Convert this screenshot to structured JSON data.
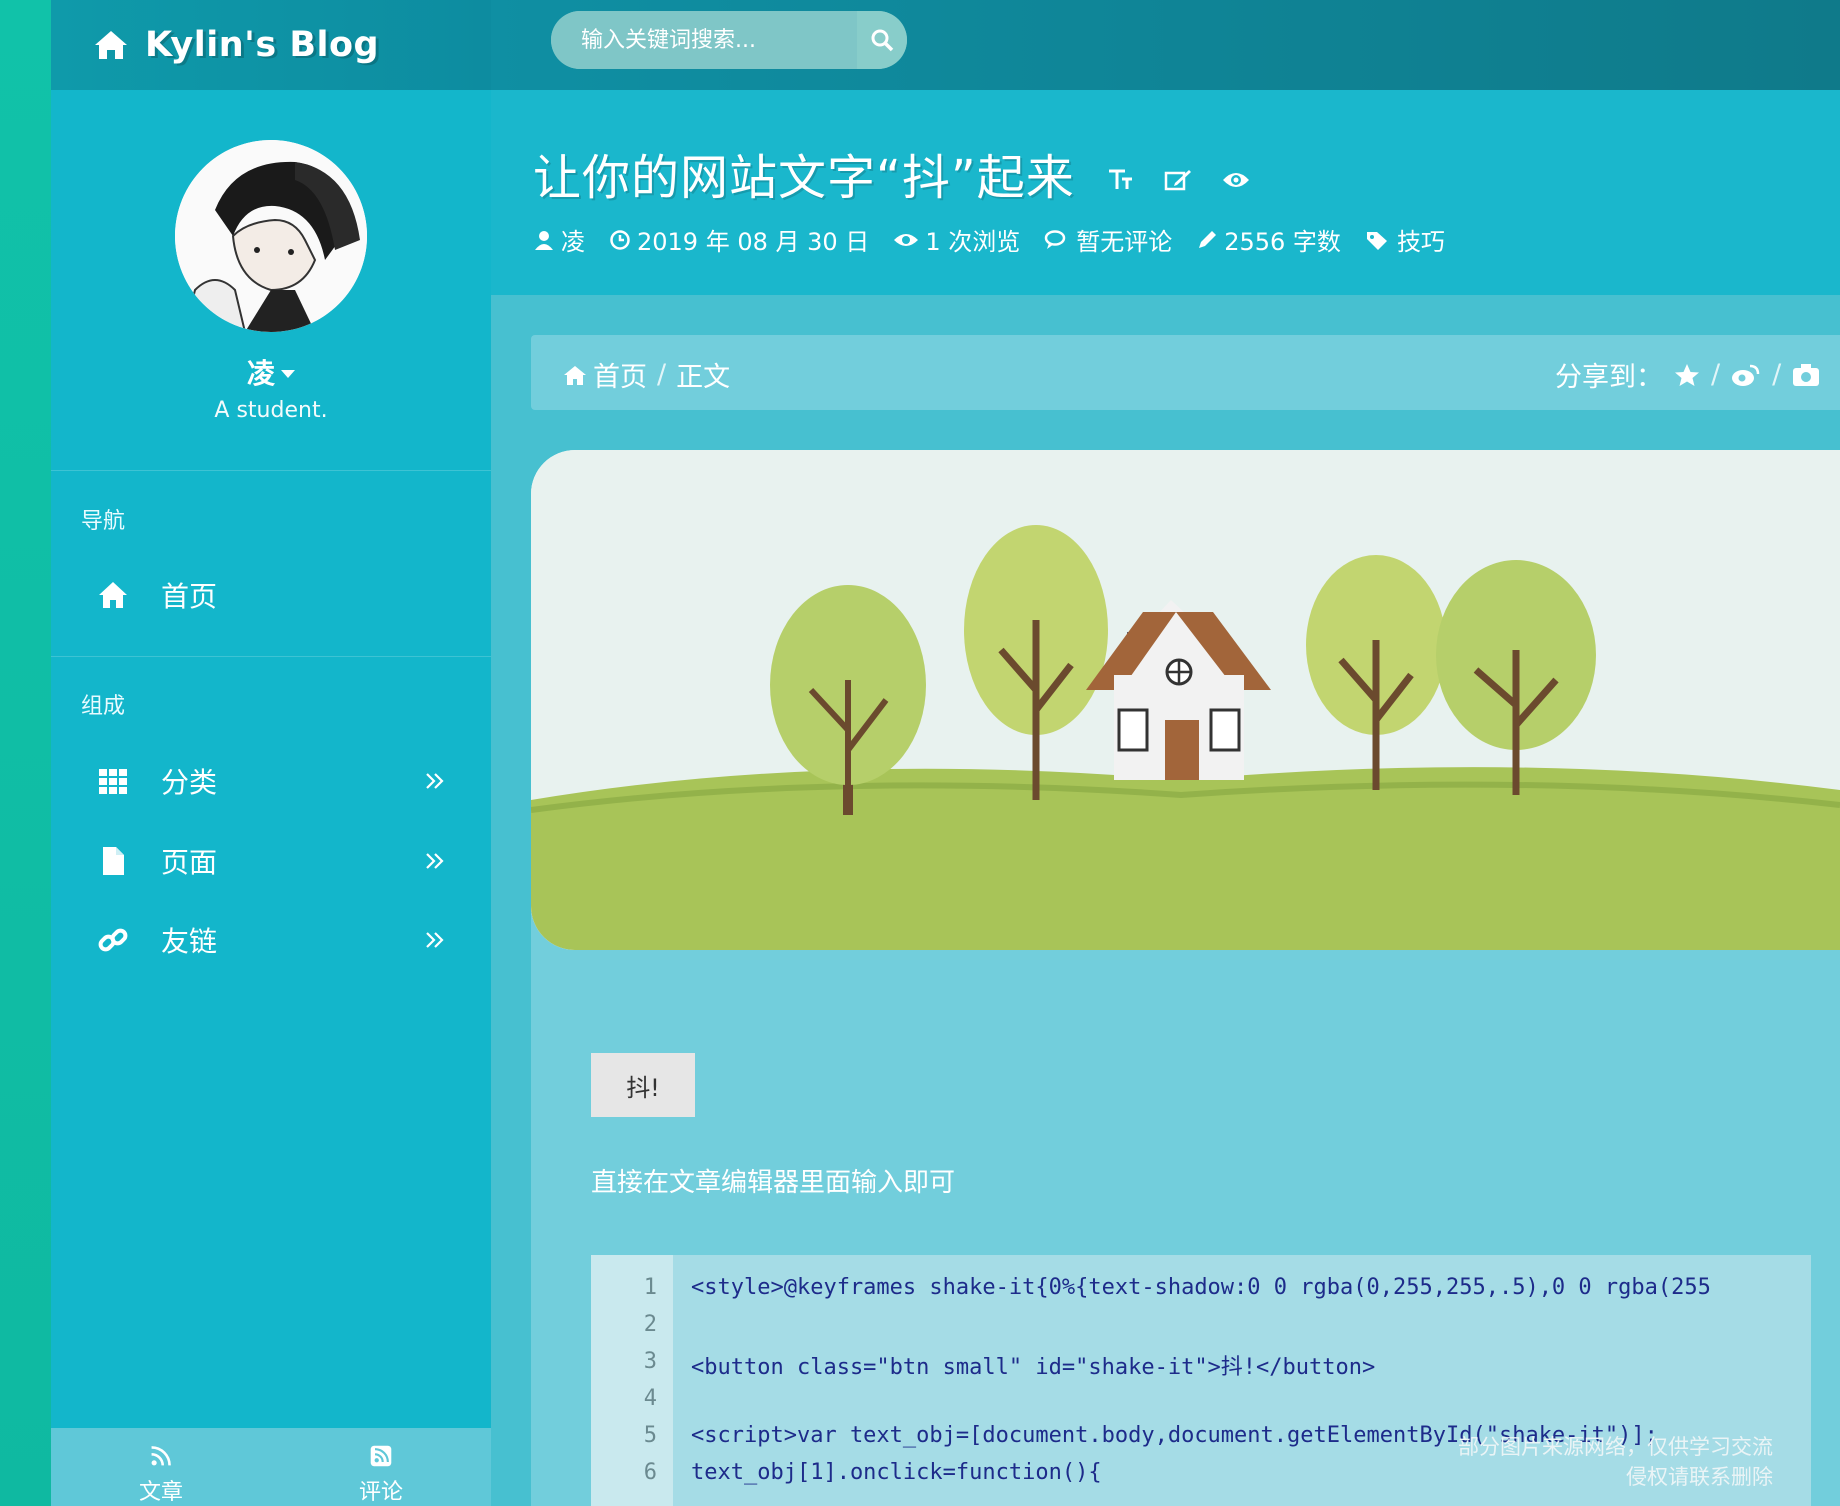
{
  "brand": {
    "title": "Kylin's Blog"
  },
  "search": {
    "placeholder": "输入关键词搜索..."
  },
  "profile": {
    "name": "凌",
    "role": "A student."
  },
  "nav": {
    "section1": "导航",
    "home": "首页",
    "section2": "组成",
    "items": [
      {
        "label": "分类",
        "icon": "grid-icon"
      },
      {
        "label": "页面",
        "icon": "file-icon"
      },
      {
        "label": "友链",
        "icon": "link-icon"
      }
    ]
  },
  "footer_tabs": [
    {
      "label": "文章",
      "icon": "rss-icon"
    },
    {
      "label": "评论",
      "icon": "rss-square-icon"
    }
  ],
  "post": {
    "title": "让你的网站文字“抖”起来",
    "meta": {
      "author": "凌",
      "date": "2019 年 08 月 30 日",
      "views": "1 次浏览",
      "comments": "暂无评论",
      "words": "2556 字数",
      "tag": "技巧"
    }
  },
  "breadcrumb": {
    "home": "首页",
    "sep": "/",
    "current": "正文"
  },
  "share": {
    "label": "分享到：",
    "sep": "/"
  },
  "article": {
    "button": "抖!",
    "desc": "直接在文章编辑器里面输入即可"
  },
  "code": {
    "lines": [
      {
        "n": "1",
        "text": "<style>@keyframes shake-it{0%{text-shadow:0 0 rgba(0,255,255,.5),0 0 rgba(255"
      },
      {
        "n": "2",
        "text": ""
      },
      {
        "n": "3",
        "text": "<button class=\"btn small\" id=\"shake-it\">抖!</button>"
      },
      {
        "n": "4",
        "text": ""
      },
      {
        "n": "5",
        "text": "<script>var text_obj=[document.body,document.getElementById(\"shake-it\")];"
      },
      {
        "n": "6",
        "text": "    text_obj[1].onclick=function(){"
      }
    ]
  },
  "notice": {
    "line1": "部分图片来源网络，仅供学习交流",
    "line2": "侵权请联系删除"
  },
  "colors": {
    "sidebar": "#13b6cb",
    "topbar": "#0f8fa3",
    "content": "#47c0d0",
    "card": "#72cedc"
  }
}
